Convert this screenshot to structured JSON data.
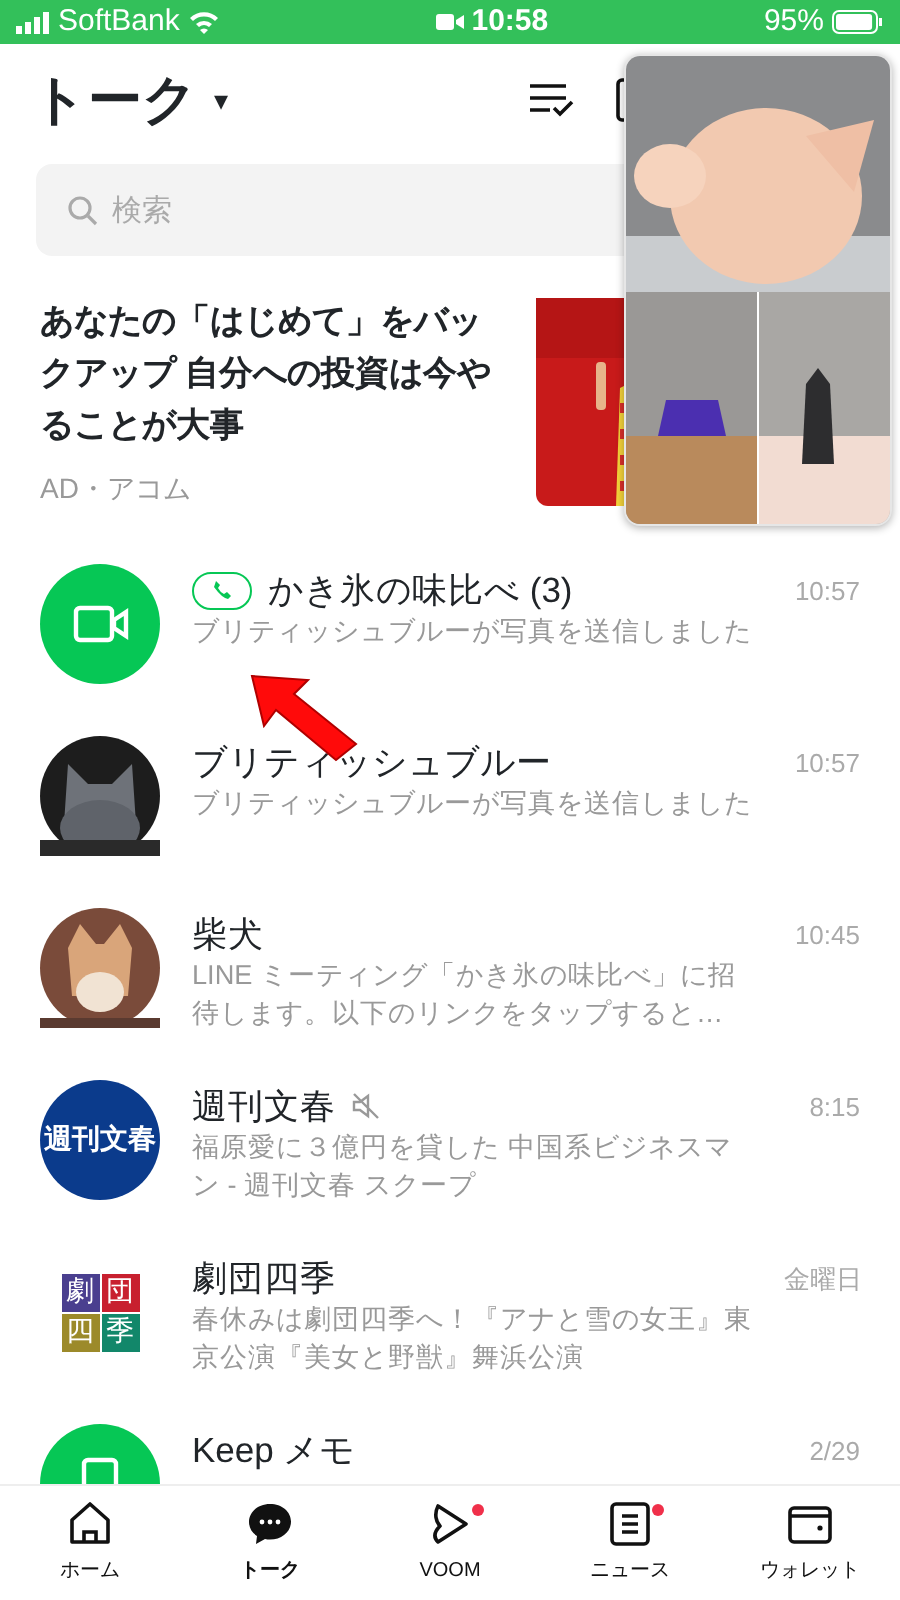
{
  "status_bar": {
    "carrier": "SoftBank",
    "time": "10:58",
    "battery": "95%"
  },
  "header": {
    "title": "トーク",
    "caret": "▾"
  },
  "search": {
    "placeholder": "検索"
  },
  "ad": {
    "text": "あなたの「はじめて」をバックアップ 自分への投資は今やることが大事",
    "sponsor": "AD・アコム"
  },
  "chats": [
    {
      "kind": "video",
      "name": "かき氷の味比べ (3)",
      "in_call": true,
      "muted": false,
      "time": "10:57",
      "preview": "ブリティッシュブルーが写真を送信しました"
    },
    {
      "kind": "cat",
      "name": "ブリティッシュブルー",
      "in_call": false,
      "muted": false,
      "time": "10:57",
      "preview": "ブリティッシュブルーが写真を送信しました"
    },
    {
      "kind": "dog",
      "name": "柴犬",
      "in_call": false,
      "muted": false,
      "time": "10:45",
      "preview": "LINE ミーティング「かき氷の味比べ」に招待します。以下のリンクをタップすると…"
    },
    {
      "kind": "round-logo",
      "logo": "週刊文春",
      "name": "週刊文春",
      "in_call": false,
      "muted": true,
      "time": "8:15",
      "preview": "福原愛に３億円を貸した 中国系ビジネスマン - 週刊文春 スクープ"
    },
    {
      "kind": "tile-logo",
      "tiles": [
        {
          "text": "劇",
          "color": "#4a3f8f"
        },
        {
          "text": "団",
          "color": "#c8202f"
        },
        {
          "text": "四",
          "color": "#9c8a2a"
        },
        {
          "text": "季",
          "color": "#12876a"
        }
      ],
      "name": "劇団四季",
      "in_call": false,
      "muted": false,
      "time": "金曜日",
      "preview": "春休みは劇団四季へ！『アナと雪の女王』東京公演『美女と野獣』舞浜公演"
    },
    {
      "kind": "keep",
      "name": "Keep メモ",
      "in_call": false,
      "muted": false,
      "time": "2/29"
    }
  ],
  "tabs": [
    {
      "label": "ホーム",
      "selected": false,
      "notification": false
    },
    {
      "label": "トーク",
      "selected": true,
      "notification": false
    },
    {
      "label": "VOOM",
      "selected": false,
      "notification": true
    },
    {
      "label": "ニュース",
      "selected": false,
      "notification": true
    },
    {
      "label": "ウォレット",
      "selected": false,
      "notification": false
    }
  ]
}
